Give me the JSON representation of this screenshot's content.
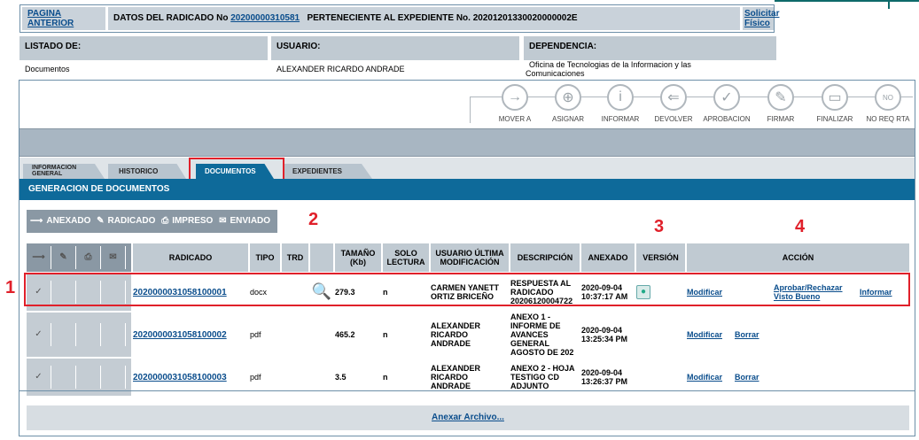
{
  "header": {
    "prev_label": "PAGINA ANTERIOR",
    "info_prefix": "DATOS DEL RADICADO No",
    "radicado_link": "20200000310581",
    "info_suffix": "PERTENECIENTE AL EXPEDIENTE No. 2020120133002000000 2E",
    "fisico_label": "Solicitar Físico"
  },
  "info": {
    "listado_label": "LISTADO DE:",
    "listado_value": "Documentos",
    "usuario_label": "USUARIO:",
    "usuario_value": "ALEXANDER RICARDO ANDRADE",
    "dependencia_label": "DEPENDENCIA:",
    "dependencia_value": "Oficina de Tecnologias de la Informacion y las Comunicaciones"
  },
  "actions": [
    {
      "label": "MOVER A",
      "icon": "arrow-right-icon"
    },
    {
      "label": "ASIGNAR",
      "icon": "assign-icon"
    },
    {
      "label": "INFORMAR",
      "icon": "info-icon"
    },
    {
      "label": "DEVOLVER",
      "icon": "return-icon"
    },
    {
      "label": "APROBACION",
      "icon": "check-icon"
    },
    {
      "label": "FIRMAR",
      "icon": "sign-icon"
    },
    {
      "label": "FINALIZAR",
      "icon": "finish-icon"
    },
    {
      "label": "NO REQ RTA",
      "icon": "no-icon"
    }
  ],
  "tabs": [
    "INFORMACION GENERAL",
    "HISTORICO",
    "DOCUMENTOS",
    "EXPEDIENTES"
  ],
  "section_title": "GENERACION DE DOCUMENTOS",
  "legend": [
    "ANEXADO",
    "RADICADO",
    "IMPRESO",
    "ENVIADO"
  ],
  "table": {
    "headers": [
      "RADICADO",
      "TIPO",
      "TRD",
      "",
      "TAMAÑO (Kb)",
      "SOLO LECTURA",
      "USUARIO ÚLTIMA MODIFICACIÓN",
      "DESCRIPCIÓN",
      "ANEXADO",
      "VERSIÓN",
      "ACCIÓN"
    ],
    "rows": [
      {
        "radicado": "2020000031058100001",
        "tipo": "docx",
        "size": "279.3",
        "lectura": "n",
        "usuario": "CARMEN YANETT ORTIZ BRICEÑO",
        "descripcion": "RESPUESTA AL RADICADO 20206120004722",
        "anexado": "2020-09-04 10:37:17 AM",
        "modificar": "Modificar",
        "borrar": "",
        "aprobar": "Aprobar/Rechazar Visto Bueno",
        "informar": "Informar"
      },
      {
        "radicado": "2020000031058100002",
        "tipo": "pdf",
        "size": "465.2",
        "lectura": "n",
        "usuario": "ALEXANDER RICARDO ANDRADE",
        "descripcion": "ANEXO 1 - INFORME DE AVANCES GENERAL AGOSTO DE 202",
        "anexado": "2020-09-04 13:25:34 PM",
        "modificar": "Modificar",
        "borrar": "Borrar",
        "aprobar": "",
        "informar": ""
      },
      {
        "radicado": "2020000031058100003",
        "tipo": "pdf",
        "size": "3.5",
        "lectura": "n",
        "usuario": "ALEXANDER RICARDO ANDRADE",
        "descripcion": "ANEXO 2 - HOJA TESTIGO CD ADJUNTO",
        "anexado": "2020-09-04 13:26:37 PM",
        "modificar": "Modificar",
        "borrar": "Borrar",
        "aprobar": "",
        "informar": ""
      }
    ]
  },
  "footer_link": "Anexar Archivo...",
  "annotations": [
    "1",
    "2",
    "3",
    "4"
  ]
}
